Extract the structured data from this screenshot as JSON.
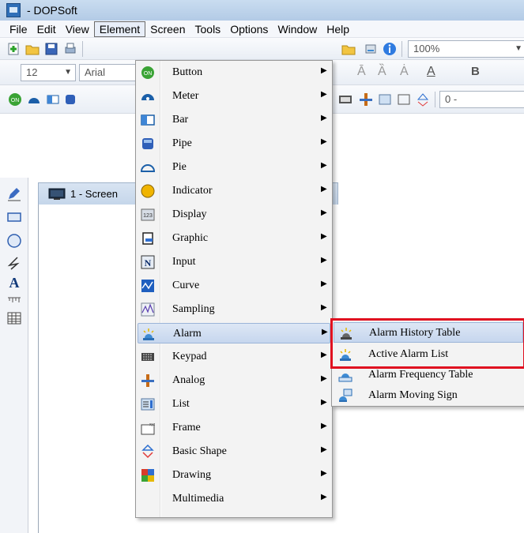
{
  "window": {
    "title": "- DOPSoft"
  },
  "menubar": {
    "items": [
      "File",
      "Edit",
      "View",
      "Element",
      "Screen",
      "Tools",
      "Options",
      "Window",
      "Help"
    ],
    "active": "Element"
  },
  "toolbar": {
    "zoom": "100%",
    "font_size": "12",
    "font_name": "Arial",
    "range_prefix": "0 -"
  },
  "document": {
    "tab_title": "1 - Screen"
  },
  "element_menu": {
    "items": [
      {
        "label": "Button",
        "icon": "button-icon",
        "submenu": true
      },
      {
        "label": "Meter",
        "icon": "meter-icon",
        "submenu": true
      },
      {
        "label": "Bar",
        "icon": "bar-icon",
        "submenu": true
      },
      {
        "label": "Pipe",
        "icon": "pipe-icon",
        "submenu": true
      },
      {
        "label": "Pie",
        "icon": "pie-icon",
        "submenu": true
      },
      {
        "label": "Indicator",
        "icon": "indicator-icon",
        "submenu": true
      },
      {
        "label": "Display",
        "icon": "display-icon",
        "submenu": true
      },
      {
        "label": "Graphic",
        "icon": "graphic-icon",
        "submenu": true
      },
      {
        "label": "Input",
        "icon": "input-icon",
        "submenu": true
      },
      {
        "label": "Curve",
        "icon": "curve-icon",
        "submenu": true
      },
      {
        "label": "Sampling",
        "icon": "sampling-icon",
        "submenu": true
      },
      {
        "label": "Alarm",
        "icon": "alarm-icon",
        "submenu": true,
        "highlighted": true
      },
      {
        "label": "Keypad",
        "icon": "keypad-icon",
        "submenu": true
      },
      {
        "label": "Analog",
        "icon": "analog-icon",
        "submenu": true
      },
      {
        "label": "List",
        "icon": "list-icon",
        "submenu": true
      },
      {
        "label": "Frame",
        "icon": "frame-icon",
        "submenu": true
      },
      {
        "label": "Basic Shape",
        "icon": "basic-shape-icon",
        "submenu": true
      },
      {
        "label": "Drawing",
        "icon": "drawing-icon",
        "submenu": true
      },
      {
        "label": "Multimedia",
        "icon": "",
        "submenu": true
      }
    ]
  },
  "alarm_submenu": {
    "items": [
      {
        "label": "Alarm History Table",
        "icon": "alarm-history-icon",
        "highlighted": true
      },
      {
        "label": "Active Alarm List",
        "icon": "active-alarm-icon"
      },
      {
        "label": "Alarm Frequency Table",
        "icon": "alarm-frequency-icon"
      },
      {
        "label": "Alarm Moving Sign",
        "icon": "alarm-moving-sign-icon"
      }
    ]
  },
  "colors": {
    "highlight_box": "#e01020",
    "menu_highlight": "#c6d6ee"
  }
}
